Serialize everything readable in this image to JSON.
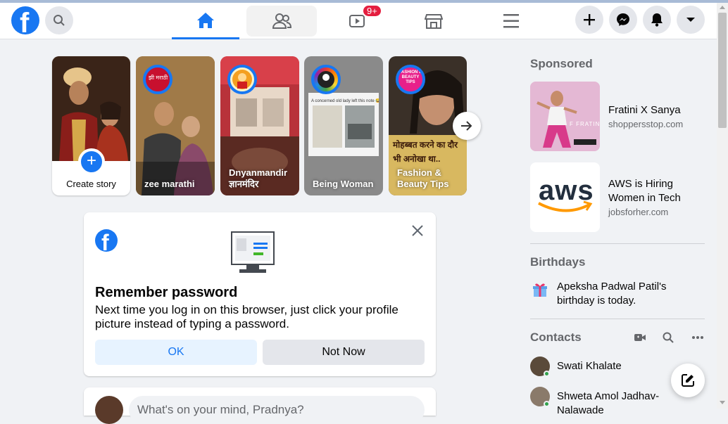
{
  "header": {
    "logo_letter": "f",
    "notifications_badge": "9+"
  },
  "stories": {
    "create_label": "Create story",
    "items": [
      {
        "name": "zee marathi",
        "avatar_text": "झी मराठी"
      },
      {
        "name": "Dnyanmandir ज्ञानमंदिर"
      },
      {
        "name": "Being Woman",
        "screen_text": "A concerned old lady left this note 😂"
      },
      {
        "name": "Fashion & Beauty Tips",
        "avatar_text": "FASHION & BEAUTY TIPS",
        "overlay_text": "मोहब्बत करने का दौर भी अनोखा था.."
      }
    ]
  },
  "remember_password": {
    "title": "Remember password",
    "text": "Next time you log in on this browser, just click your profile picture instead of typing a password.",
    "ok_label": "OK",
    "not_now_label": "Not Now"
  },
  "composer": {
    "placeholder": "What's on your mind, Pradnya?"
  },
  "sidebar": {
    "sponsored_title": "Sponsored",
    "ads": [
      {
        "title": "Fratini X Sanya",
        "url": "shoppersstop.com",
        "image_text": "F FRATINI"
      },
      {
        "title": "AWS is Hiring Women in Tech",
        "url": "jobsforher.com",
        "image_text": "aws"
      }
    ],
    "birthdays_title": "Birthdays",
    "birthday_text": "Apeksha Padwal Patil's birthday is today.",
    "contacts_title": "Contacts",
    "contacts": [
      {
        "name": "Swati Khalate"
      },
      {
        "name": "Shweta Amol Jadhav-Nalawade"
      }
    ]
  },
  "colors": {
    "brand": "#1877f2",
    "badge": "#e41e3f",
    "online": "#31a24c"
  }
}
